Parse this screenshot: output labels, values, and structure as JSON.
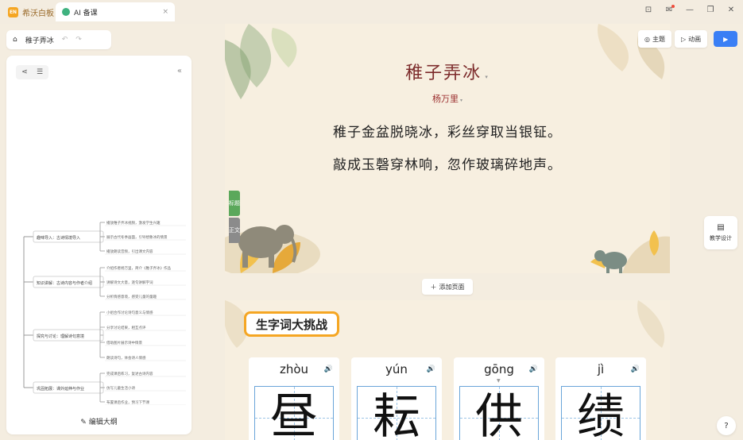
{
  "titlebar": {
    "app_badge": "EN",
    "app_name": "希沃白板",
    "tab_label": "AI 备课",
    "tab_close": "×",
    "controls": [
      "⊡",
      "✉",
      "—",
      "❐",
      "✕"
    ]
  },
  "breadcrumb": {
    "home_icon": "⌂",
    "title": "稚子弄冰",
    "undo": "↶",
    "redo": "↷"
  },
  "sidebar": {
    "collapse": "«",
    "edit_outline_label": "编辑大纲",
    "mindmap": {
      "branches": [
        {
          "label": "趣味导入：古诗情境导入",
          "children": [
            "播放稚子弄冰视频，激发学生兴趣",
            "展示古代冬季画面，引导想象冰的情景",
            "播放朗读音频，引出课文内容"
          ]
        },
        {
          "label": "知识讲解：古诗内容与作者介绍",
          "children": [
            "介绍作者杨万里，简介《稚子弄冰》作品",
            "讲解诗文大意，逐句讲解字词",
            "分析情感意境，感受儿童的童趣"
          ]
        },
        {
          "label": "探究与讨论：理解诗句意境",
          "children": [
            "小组合作讨论诗句意义与情感",
            "分享讨论结果，相互点评",
            "借助图片展示诗中情景",
            "朗读诗句，体会诗人情感"
          ]
        },
        {
          "label": "巩固拓展：课外延伸与作业",
          "children": [
            "完成课后练习，复述古诗内容",
            "仿写儿童生活小诗",
            "布置课后作业，预习下节课"
          ]
        }
      ]
    }
  },
  "slide1": {
    "title": "稚子弄冰",
    "author": "杨万里",
    "lines": [
      "稚子金盆脱晓冰，彩丝穿取当银钲。",
      "敲成玉磬穿林响，忽作玻璃碎地声。"
    ],
    "side_tabs": [
      "标题",
      "正文"
    ]
  },
  "toolbar": {
    "theme_label": "主题",
    "animation_label": "动画",
    "play_icon": "▶"
  },
  "teach_design_label": "教学设计",
  "add_page_label": "添加页面",
  "help_label": "?",
  "slide2": {
    "heading": "生字词大挑战",
    "cards": [
      {
        "pinyin": "zhòu",
        "char": "昼"
      },
      {
        "pinyin": "yún",
        "char": "耘"
      },
      {
        "pinyin": "gōng",
        "char": "供"
      },
      {
        "pinyin": "jì",
        "char": "绩"
      }
    ]
  }
}
